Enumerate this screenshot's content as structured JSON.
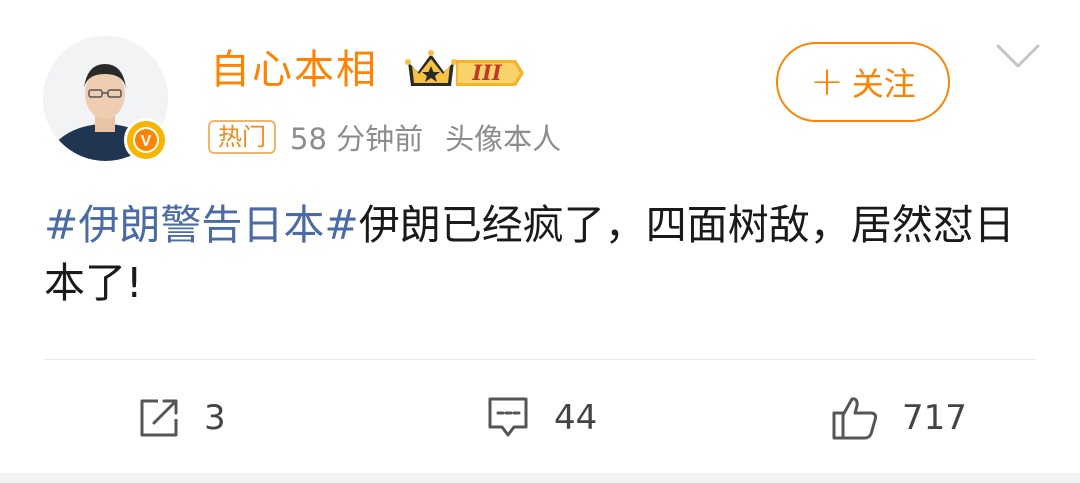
{
  "user": {
    "name": "自心本相",
    "member_level": "III",
    "verified_mark": "V"
  },
  "meta": {
    "hot_tag": "热门",
    "time": "58 分钟前",
    "avatar_note": "头像本人"
  },
  "follow": {
    "plus": "+",
    "label": "关注"
  },
  "post": {
    "hashtag": "#伊朗警告日本#",
    "text": "伊朗已经疯了，四面树敌，居然怼日本了!"
  },
  "actions": {
    "repost_count": "3",
    "comment_count": "44",
    "like_count": "717"
  },
  "colors": {
    "brand_orange": "#ff8200",
    "hashtag_blue": "#4b6ba6",
    "meta_gray": "#8c8c8c",
    "badge_gold": "#f7b500"
  },
  "icons": [
    "chevron-down-icon",
    "repost-icon",
    "comment-icon",
    "like-icon",
    "crown-icon",
    "verified-icon"
  ]
}
